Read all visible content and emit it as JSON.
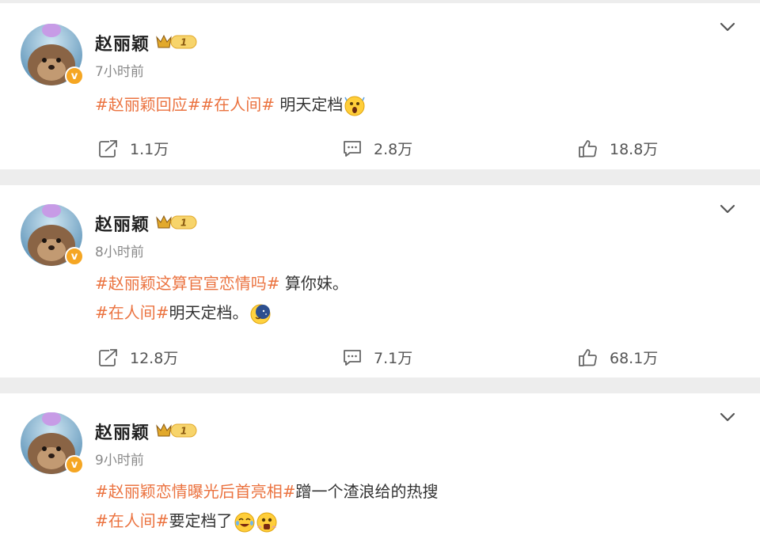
{
  "posts": [
    {
      "name": "赵丽颖",
      "level": "1",
      "time": "7小时前",
      "lines": [
        {
          "tags": "#赵丽颖回应##在人间#",
          "text": " 明天定档"
        }
      ],
      "emojis": [
        "shocked-face-emoji"
      ],
      "stats": {
        "share": "1.1万",
        "comment": "2.8万",
        "like": "18.8万"
      }
    },
    {
      "name": "赵丽颖",
      "level": "1",
      "time": "8小时前",
      "lines": [
        {
          "tags": "#赵丽颖这算官宣恋情吗#",
          "text": " 算你妹。"
        },
        {
          "tags": "#在人间#",
          "text": "明天定档。"
        }
      ],
      "emojis": [
        "moon-emoji"
      ],
      "stats": {
        "share": "12.8万",
        "comment": "7.1万",
        "like": "68.1万"
      }
    },
    {
      "name": "赵丽颖",
      "level": "1",
      "time": "9小时前",
      "lines": [
        {
          "tags": "#赵丽颖恋情曝光后首亮相#",
          "text": "蹭一个渣浪给的热搜"
        },
        {
          "tags": "#在人间#",
          "text": "要定档了"
        }
      ],
      "emojis": [
        "crying-laugh-emoji",
        "surprised-emoji"
      ]
    }
  ],
  "colors": {
    "tag": "#eb7340",
    "badge": "#f5a623",
    "background": "#ededed"
  }
}
